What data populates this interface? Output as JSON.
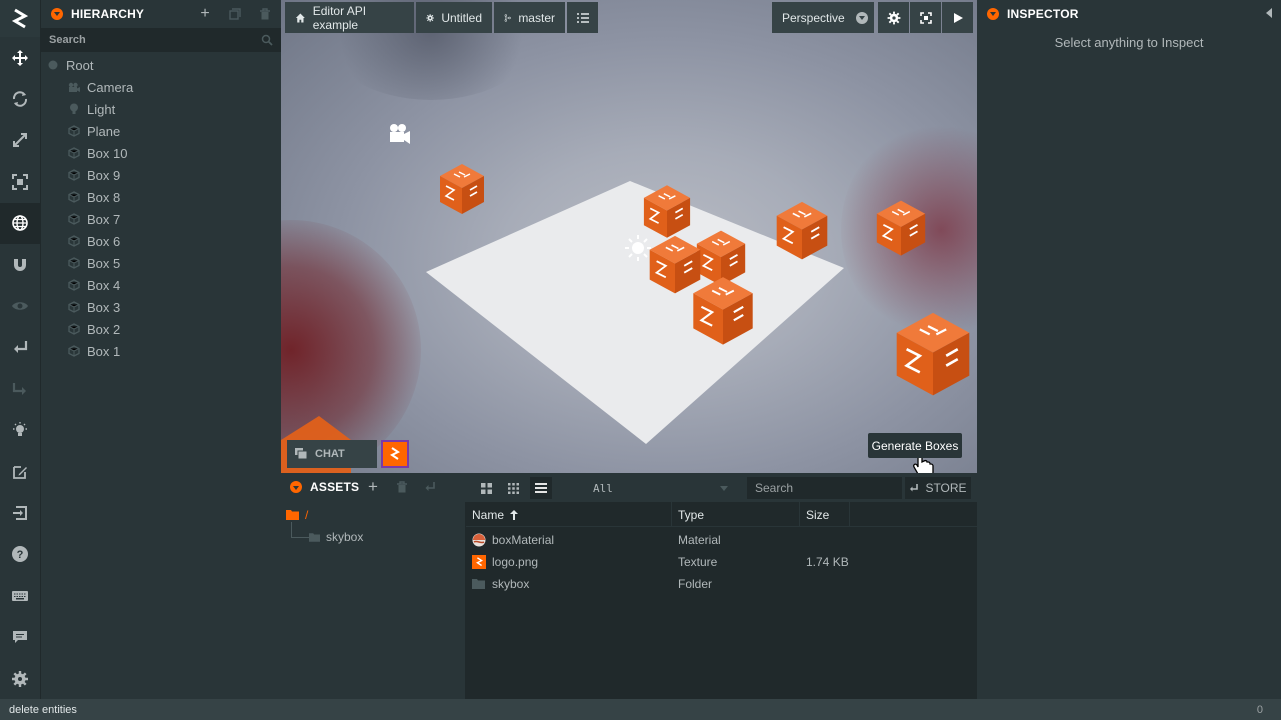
{
  "hierarchy": {
    "title": "HIERARCHY",
    "search_placeholder": "Search",
    "root_label": "Root",
    "items": [
      {
        "label": "Camera",
        "icon": "camera-icon"
      },
      {
        "label": "Light",
        "icon": "light-bulb-icon"
      },
      {
        "label": "Plane",
        "icon": "entity-icon"
      },
      {
        "label": "Box 10",
        "icon": "entity-icon"
      },
      {
        "label": "Box 9",
        "icon": "entity-icon"
      },
      {
        "label": "Box 8",
        "icon": "entity-icon"
      },
      {
        "label": "Box 7",
        "icon": "entity-icon"
      },
      {
        "label": "Box 6",
        "icon": "entity-icon"
      },
      {
        "label": "Box 5",
        "icon": "entity-icon"
      },
      {
        "label": "Box 4",
        "icon": "entity-icon"
      },
      {
        "label": "Box 3",
        "icon": "entity-icon"
      },
      {
        "label": "Box 2",
        "icon": "entity-icon"
      },
      {
        "label": "Box 1",
        "icon": "entity-icon"
      }
    ]
  },
  "topbar": {
    "project_label": "Editor API example",
    "scene_label": "Untitled",
    "branch_label": "master",
    "camera_mode": "Perspective"
  },
  "viewport": {
    "chat_label": "CHAT",
    "generate_button": "Generate Boxes"
  },
  "inspector": {
    "title": "INSPECTOR",
    "empty_message": "Select anything to Inspect"
  },
  "assets": {
    "title": "ASSETS",
    "filter_value": "All",
    "search_placeholder": "Search",
    "store_label": "STORE",
    "tree_root": "/",
    "tree_child": "skybox",
    "columns": {
      "name": "Name",
      "type": "Type",
      "size": "Size"
    },
    "rows": [
      {
        "name": "boxMaterial",
        "type": "Material",
        "size": "",
        "icon": "material-icon"
      },
      {
        "name": "logo.png",
        "type": "Texture",
        "size": "1.74 KB",
        "icon": "texture-icon"
      },
      {
        "name": "skybox",
        "type": "Folder",
        "size": "",
        "icon": "folder-icon"
      }
    ]
  },
  "status": {
    "message": "delete entities",
    "count": "0"
  },
  "colors": {
    "accent": "#ff6600",
    "panel": "#293538",
    "background": "#20292b"
  }
}
